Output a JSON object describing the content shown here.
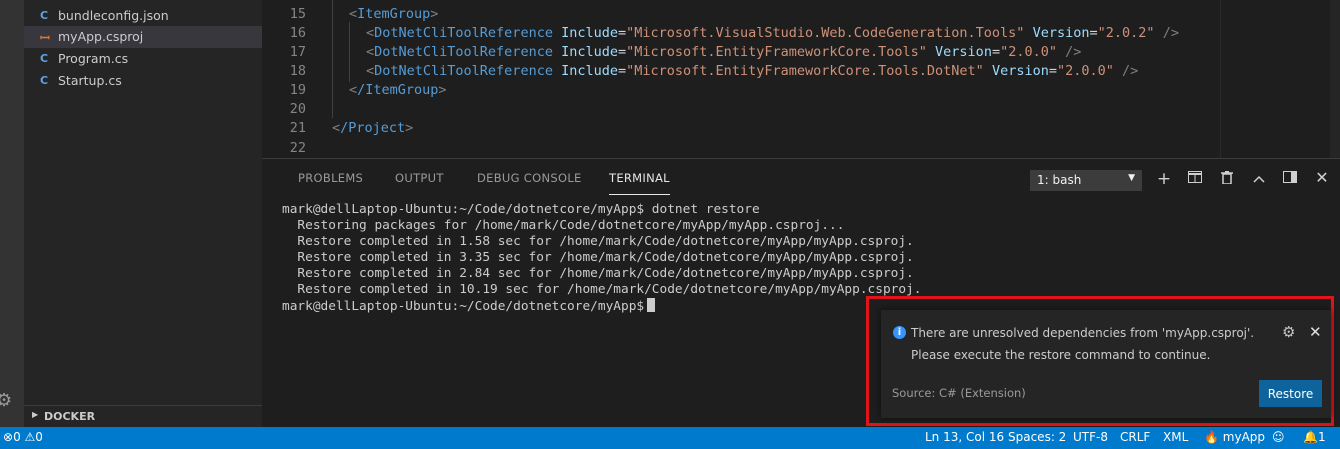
{
  "sidebar": {
    "files": [
      {
        "icon": "csharp-icon",
        "glyph": "C#",
        "label": "bundleconfig.json"
      },
      {
        "icon": "rss-icon",
        "glyph": "≡",
        "label": "myApp.csproj"
      },
      {
        "icon": "csharp-icon",
        "glyph": "C#",
        "label": "Program.cs"
      },
      {
        "icon": "csharp-icon",
        "glyph": "C#",
        "label": "Startup.cs"
      }
    ],
    "docker_label": "DOCKER"
  },
  "editor": {
    "line_numbers": [
      "15",
      "16",
      "17",
      "18",
      "19",
      "20",
      "21",
      "22"
    ],
    "lines": [
      {
        "tag": "ItemGroup"
      },
      {
        "tag": "DotNetCliToolReference",
        "include": "Microsoft.VisualStudio.Web.CodeGeneration.Tools",
        "version": "2.0.2"
      },
      {
        "tag": "DotNetCliToolReference",
        "include": "Microsoft.EntityFrameworkCore.Tools",
        "version": "2.0.0"
      },
      {
        "tag": "DotNetCliToolReference",
        "include": "Microsoft.EntityFrameworkCore.Tools.DotNet",
        "version": "2.0.0"
      },
      {
        "tag": "/ItemGroup"
      },
      {
        "tag": "/Project"
      }
    ],
    "attr_include": "Include",
    "attr_version": "Version"
  },
  "panel": {
    "tabs": [
      "PROBLEMS",
      "OUTPUT",
      "DEBUG CONSOLE",
      "TERMINAL"
    ],
    "active_tab": "TERMINAL",
    "terminal_select": "1: bash",
    "terminal_lines": [
      "mark@dellLaptop-Ubuntu:~/Code/dotnetcore/myApp$ dotnet restore",
      "  Restoring packages for /home/mark/Code/dotnetcore/myApp/myApp.csproj...",
      "  Restore completed in 1.58 sec for /home/mark/Code/dotnetcore/myApp/myApp.csproj.",
      "  Restore completed in 3.35 sec for /home/mark/Code/dotnetcore/myApp/myApp.csproj.",
      "  Restore completed in 2.84 sec for /home/mark/Code/dotnetcore/myApp/myApp.csproj.",
      "  Restore completed in 10.19 sec for /home/mark/Code/dotnetcore/myApp/myApp.csproj."
    ],
    "prompt": "mark@dellLaptop-Ubuntu:~/Code/dotnetcore/myApp$"
  },
  "notification": {
    "message_line1": "There are unresolved dependencies from 'myApp.csproj'.",
    "message_line2": "Please execute the restore command to continue.",
    "source": "Source: C# (Extension)",
    "action_label": "Restore",
    "highlight_color": "#e0141b"
  },
  "statusbar": {
    "errors": "0",
    "warnings": "0",
    "position": "Ln 13, Col 16",
    "spaces": "Spaces: 2",
    "encoding": "UTF-8",
    "eol": "CRLF",
    "language": "XML",
    "project": "myApp",
    "notifications_count": "1",
    "color": "#007acc"
  }
}
